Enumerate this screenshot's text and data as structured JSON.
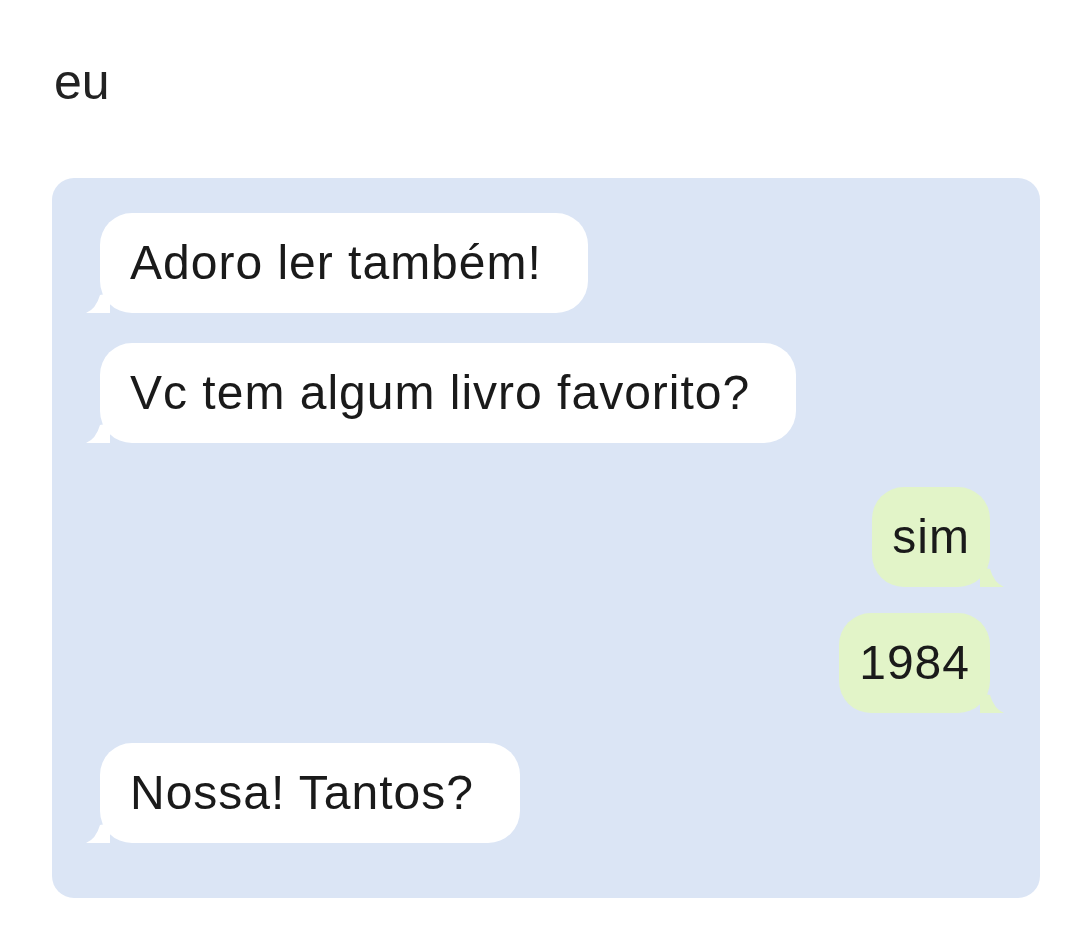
{
  "caption": "eu",
  "chat": {
    "messages": [
      {
        "kind": "incoming",
        "text": "Adoro ler também!"
      },
      {
        "kind": "incoming",
        "text": "Vc tem algum livro favorito?"
      },
      {
        "kind": "outgoing",
        "text": "sim"
      },
      {
        "kind": "outgoing",
        "text": "1984"
      },
      {
        "kind": "incoming",
        "text": "Nossa! Tantos?"
      }
    ]
  }
}
